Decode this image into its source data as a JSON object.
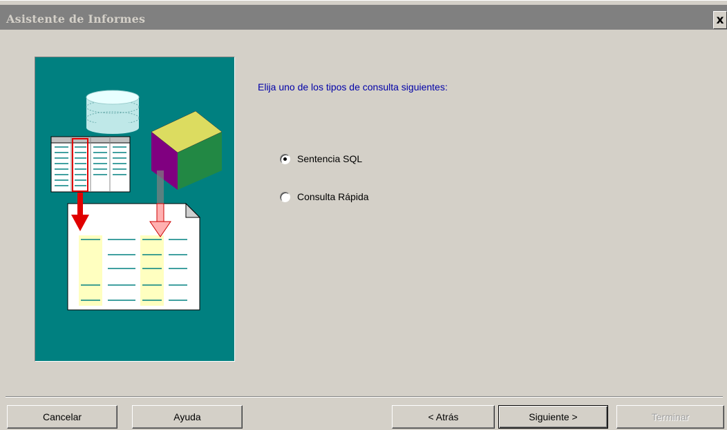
{
  "window": {
    "title": "Asistente de Informes",
    "close_label": "x"
  },
  "main": {
    "prompt": "Elija uno de los tipos de consulta siguientes:",
    "options": [
      {
        "label": "Sentencia SQL",
        "selected": true
      },
      {
        "label": "Consulta Rápida",
        "selected": false
      }
    ]
  },
  "illustration": {
    "background": "#008080",
    "icons": [
      "database-icon",
      "table-icon",
      "cube-icon",
      "report-page-icon",
      "arrow-down-icon"
    ]
  },
  "buttons": {
    "cancel": "Cancelar",
    "help": "Ayuda",
    "back": "< Atrás",
    "next": "Siguiente >",
    "finish": "Terminar"
  },
  "colors": {
    "face": "#d4d0c8",
    "titlebar_inactive": "#808080",
    "prompt_text": "#0000a8",
    "panel": "#008080"
  }
}
